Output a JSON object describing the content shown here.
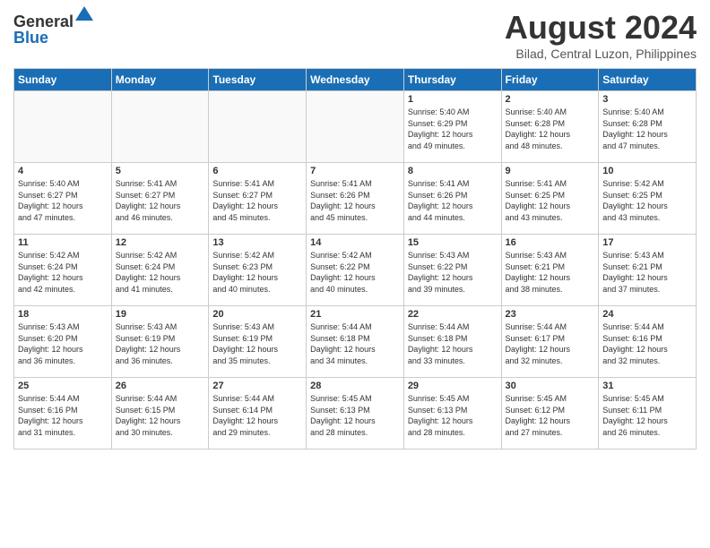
{
  "header": {
    "logo_general": "General",
    "logo_blue": "Blue",
    "month_year": "August 2024",
    "location": "Bilad, Central Luzon, Philippines"
  },
  "weekdays": [
    "Sunday",
    "Monday",
    "Tuesday",
    "Wednesday",
    "Thursday",
    "Friday",
    "Saturday"
  ],
  "weeks": [
    [
      {
        "day": "",
        "info": ""
      },
      {
        "day": "",
        "info": ""
      },
      {
        "day": "",
        "info": ""
      },
      {
        "day": "",
        "info": ""
      },
      {
        "day": "1",
        "info": "Sunrise: 5:40 AM\nSunset: 6:29 PM\nDaylight: 12 hours\nand 49 minutes."
      },
      {
        "day": "2",
        "info": "Sunrise: 5:40 AM\nSunset: 6:28 PM\nDaylight: 12 hours\nand 48 minutes."
      },
      {
        "day": "3",
        "info": "Sunrise: 5:40 AM\nSunset: 6:28 PM\nDaylight: 12 hours\nand 47 minutes."
      }
    ],
    [
      {
        "day": "4",
        "info": "Sunrise: 5:40 AM\nSunset: 6:27 PM\nDaylight: 12 hours\nand 47 minutes."
      },
      {
        "day": "5",
        "info": "Sunrise: 5:41 AM\nSunset: 6:27 PM\nDaylight: 12 hours\nand 46 minutes."
      },
      {
        "day": "6",
        "info": "Sunrise: 5:41 AM\nSunset: 6:27 PM\nDaylight: 12 hours\nand 45 minutes."
      },
      {
        "day": "7",
        "info": "Sunrise: 5:41 AM\nSunset: 6:26 PM\nDaylight: 12 hours\nand 45 minutes."
      },
      {
        "day": "8",
        "info": "Sunrise: 5:41 AM\nSunset: 6:26 PM\nDaylight: 12 hours\nand 44 minutes."
      },
      {
        "day": "9",
        "info": "Sunrise: 5:41 AM\nSunset: 6:25 PM\nDaylight: 12 hours\nand 43 minutes."
      },
      {
        "day": "10",
        "info": "Sunrise: 5:42 AM\nSunset: 6:25 PM\nDaylight: 12 hours\nand 43 minutes."
      }
    ],
    [
      {
        "day": "11",
        "info": "Sunrise: 5:42 AM\nSunset: 6:24 PM\nDaylight: 12 hours\nand 42 minutes."
      },
      {
        "day": "12",
        "info": "Sunrise: 5:42 AM\nSunset: 6:24 PM\nDaylight: 12 hours\nand 41 minutes."
      },
      {
        "day": "13",
        "info": "Sunrise: 5:42 AM\nSunset: 6:23 PM\nDaylight: 12 hours\nand 40 minutes."
      },
      {
        "day": "14",
        "info": "Sunrise: 5:42 AM\nSunset: 6:22 PM\nDaylight: 12 hours\nand 40 minutes."
      },
      {
        "day": "15",
        "info": "Sunrise: 5:43 AM\nSunset: 6:22 PM\nDaylight: 12 hours\nand 39 minutes."
      },
      {
        "day": "16",
        "info": "Sunrise: 5:43 AM\nSunset: 6:21 PM\nDaylight: 12 hours\nand 38 minutes."
      },
      {
        "day": "17",
        "info": "Sunrise: 5:43 AM\nSunset: 6:21 PM\nDaylight: 12 hours\nand 37 minutes."
      }
    ],
    [
      {
        "day": "18",
        "info": "Sunrise: 5:43 AM\nSunset: 6:20 PM\nDaylight: 12 hours\nand 36 minutes."
      },
      {
        "day": "19",
        "info": "Sunrise: 5:43 AM\nSunset: 6:19 PM\nDaylight: 12 hours\nand 36 minutes."
      },
      {
        "day": "20",
        "info": "Sunrise: 5:43 AM\nSunset: 6:19 PM\nDaylight: 12 hours\nand 35 minutes."
      },
      {
        "day": "21",
        "info": "Sunrise: 5:44 AM\nSunset: 6:18 PM\nDaylight: 12 hours\nand 34 minutes."
      },
      {
        "day": "22",
        "info": "Sunrise: 5:44 AM\nSunset: 6:18 PM\nDaylight: 12 hours\nand 33 minutes."
      },
      {
        "day": "23",
        "info": "Sunrise: 5:44 AM\nSunset: 6:17 PM\nDaylight: 12 hours\nand 32 minutes."
      },
      {
        "day": "24",
        "info": "Sunrise: 5:44 AM\nSunset: 6:16 PM\nDaylight: 12 hours\nand 32 minutes."
      }
    ],
    [
      {
        "day": "25",
        "info": "Sunrise: 5:44 AM\nSunset: 6:16 PM\nDaylight: 12 hours\nand 31 minutes."
      },
      {
        "day": "26",
        "info": "Sunrise: 5:44 AM\nSunset: 6:15 PM\nDaylight: 12 hours\nand 30 minutes."
      },
      {
        "day": "27",
        "info": "Sunrise: 5:44 AM\nSunset: 6:14 PM\nDaylight: 12 hours\nand 29 minutes."
      },
      {
        "day": "28",
        "info": "Sunrise: 5:45 AM\nSunset: 6:13 PM\nDaylight: 12 hours\nand 28 minutes."
      },
      {
        "day": "29",
        "info": "Sunrise: 5:45 AM\nSunset: 6:13 PM\nDaylight: 12 hours\nand 28 minutes."
      },
      {
        "day": "30",
        "info": "Sunrise: 5:45 AM\nSunset: 6:12 PM\nDaylight: 12 hours\nand 27 minutes."
      },
      {
        "day": "31",
        "info": "Sunrise: 5:45 AM\nSunset: 6:11 PM\nDaylight: 12 hours\nand 26 minutes."
      }
    ]
  ]
}
